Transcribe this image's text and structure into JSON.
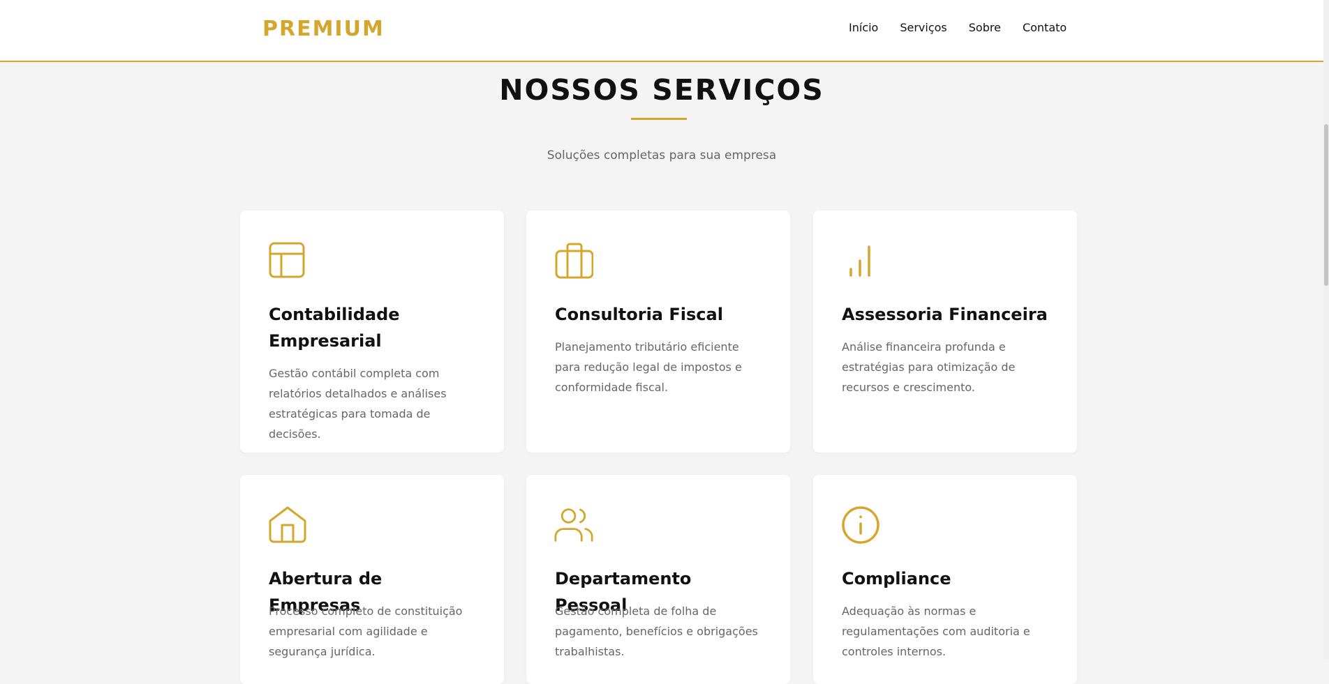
{
  "header": {
    "logo": "PREMIUM",
    "nav": [
      "Início",
      "Serviços",
      "Sobre",
      "Contato"
    ]
  },
  "section": {
    "title": "NOSSOS SERVIÇOS",
    "subtitle": "Soluções completas para sua empresa"
  },
  "services": [
    {
      "icon": "layout-icon",
      "title": "Contabilidade Empresarial",
      "description": "Gestão contábil completa com relatórios detalhados e análises estratégicas para tomada de decisões."
    },
    {
      "icon": "briefcase-icon",
      "title": "Consultoria Fiscal",
      "description": "Planejamento tributário eficiente para redução legal de impostos e conformidade fiscal."
    },
    {
      "icon": "bar-chart-icon",
      "title": "Assessoria Financeira",
      "description": "Análise financeira profunda e estratégias para otimização de recursos e crescimento."
    },
    {
      "icon": "home-icon",
      "title": "Abertura de Empresas",
      "description": "Processo completo de constituição empresarial com agilidade e segurança jurídica."
    },
    {
      "icon": "users-icon",
      "title": "Departamento Pessoal",
      "description": "Gestão completa de folha de pagamento, benefícios e obrigações trabalhistas."
    },
    {
      "icon": "info-icon",
      "title": "Compliance",
      "description": "Adequação às normas e regulamentações com auditoria e controles internos."
    }
  ],
  "colors": {
    "accent": "#d4a72c",
    "background": "#f4f4f4",
    "card": "#ffffff",
    "text": "#111111",
    "muted": "#666666"
  }
}
